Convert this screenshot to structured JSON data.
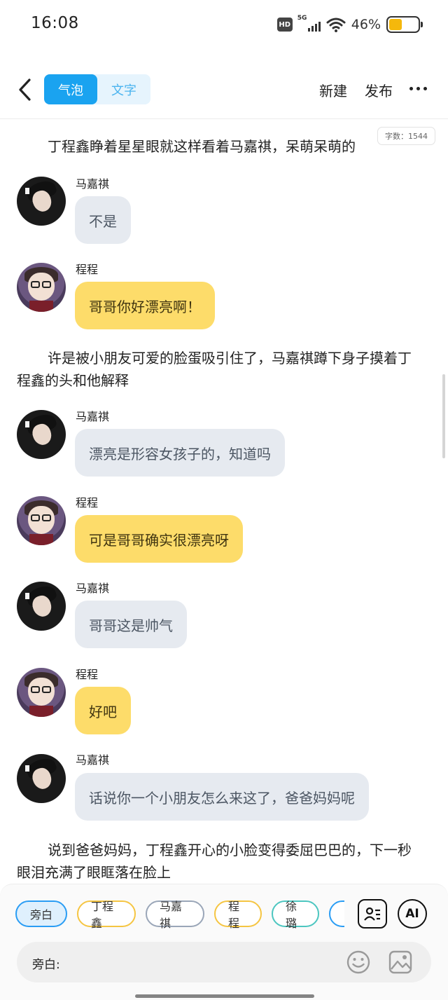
{
  "status_bar": {
    "time": "16:08",
    "hd": "HD",
    "network": "5G",
    "battery_percent": "46%",
    "battery_level": 0.46,
    "battery_color": "#f5b80c"
  },
  "header": {
    "tabs": [
      {
        "label": "气泡",
        "active": true
      },
      {
        "label": "文字",
        "active": false
      }
    ],
    "new_label": "新建",
    "publish_label": "发布",
    "back_icon": "chevron-left-icon",
    "more_icon": "more-horizontal-icon"
  },
  "word_count": "字数：1544",
  "story": [
    {
      "kind": "narration",
      "text": "丁程鑫睁着星星眼就这样看着马嘉祺，呆萌呆萌的"
    },
    {
      "kind": "message",
      "speaker": "马嘉祺",
      "text": "不是",
      "style": "grey"
    },
    {
      "kind": "message",
      "speaker": "程程",
      "text": "哥哥你好漂亮啊！",
      "style": "yellow"
    },
    {
      "kind": "narration",
      "text": "许是被小朋友可爱的脸蛋吸引住了，马嘉祺蹲下身子摸着丁程鑫的头和他解释"
    },
    {
      "kind": "message",
      "speaker": "马嘉祺",
      "text": "漂亮是形容女孩子的，知道吗",
      "style": "grey"
    },
    {
      "kind": "message",
      "speaker": "程程",
      "text": "可是哥哥确实很漂亮呀",
      "style": "yellow"
    },
    {
      "kind": "message",
      "speaker": "马嘉祺",
      "text": "哥哥这是帅气",
      "style": "grey"
    },
    {
      "kind": "message",
      "speaker": "程程",
      "text": "好吧",
      "style": "yellow"
    },
    {
      "kind": "message",
      "speaker": "马嘉祺",
      "text": "话说你一个小朋友怎么来这了，爸爸妈妈呢",
      "style": "grey"
    },
    {
      "kind": "narration",
      "text": "说到爸爸妈妈，丁程鑫开心的小脸变得委屈巴巴的，下一秒眼泪充满了眼眶落在脸上"
    }
  ],
  "bubble_colors": {
    "grey": "#e6eaf0",
    "yellow": "#fddc6a"
  },
  "roles": [
    {
      "label": "旁白",
      "selected": true
    },
    {
      "label": "丁程鑫",
      "selected": false
    },
    {
      "label": "马嘉祺",
      "selected": false
    },
    {
      "label": "程程",
      "selected": false
    },
    {
      "label": "徐璐",
      "selected": false
    }
  ],
  "role_manage_icon": "role-card-icon",
  "ai_label": "AI",
  "input": {
    "label": "旁白:",
    "emoji_icon": "emoji-icon",
    "image_icon": "image-icon"
  }
}
